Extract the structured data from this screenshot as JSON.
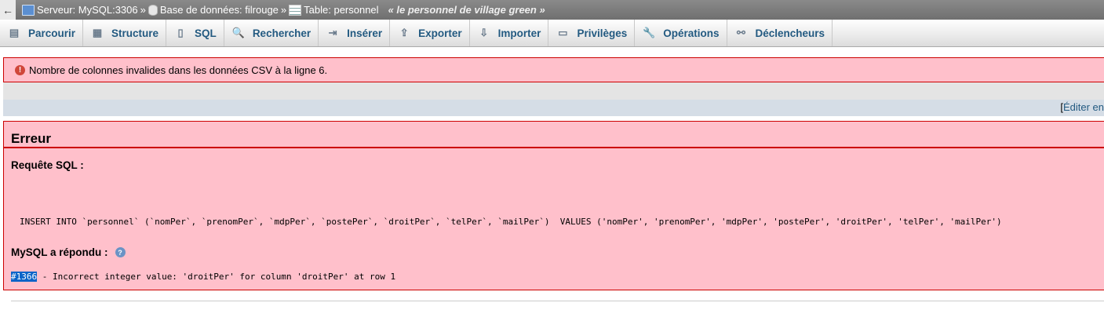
{
  "breadcrumb": {
    "back": "←",
    "server": "Serveur: MySQL:3306",
    "database": "Base de données: filrouge",
    "table": "Table: personnel",
    "separator": "»",
    "comment": "« le personnel de village green »"
  },
  "tabs": [
    {
      "label": "Parcourir",
      "icon": "browse-icon",
      "glyph": "▤"
    },
    {
      "label": "Structure",
      "icon": "structure-icon",
      "glyph": "▦"
    },
    {
      "label": "SQL",
      "icon": "sql-icon",
      "glyph": "▯"
    },
    {
      "label": "Rechercher",
      "icon": "search-icon",
      "glyph": "🔍"
    },
    {
      "label": "Insérer",
      "icon": "insert-icon",
      "glyph": "⇥"
    },
    {
      "label": "Exporter",
      "icon": "export-icon",
      "glyph": "⇪"
    },
    {
      "label": "Importer",
      "icon": "import-icon",
      "glyph": "⇩"
    },
    {
      "label": "Privilèges",
      "icon": "privileges-icon",
      "glyph": "▭"
    },
    {
      "label": "Opérations",
      "icon": "wrench-icon",
      "glyph": "🔧"
    },
    {
      "label": "Déclencheurs",
      "icon": "triggers-icon",
      "glyph": "⚯"
    }
  ],
  "notice": {
    "icon": "error-icon",
    "text": "Nombre de colonnes invalides dans les données CSV à la ligne 6."
  },
  "edit_link": {
    "bracket": "[",
    "label": "Éditer en"
  },
  "error": {
    "title": "Erreur",
    "sql_label": "Requête SQL :",
    "sql_query": "INSERT INTO `personnel` (`nomPer`, `prenomPer`, `mdpPer`, `postePer`, `droitPer`, `telPer`, `mailPer`)  VALUES ('nomPer', 'prenomPer', 'mdpPer', 'postePer', 'droitPer', 'telPer', 'mailPer')",
    "response_label": "MySQL a répondu :",
    "code": "#1366",
    "message": " - Incorrect integer value: 'droitPer' for column 'droitPer' at row 1"
  },
  "colors": {
    "error_bg": "#ffc0cb",
    "error_border": "#cc0000",
    "tab_text": "#235a81",
    "topbar": "#7a7a7a"
  }
}
